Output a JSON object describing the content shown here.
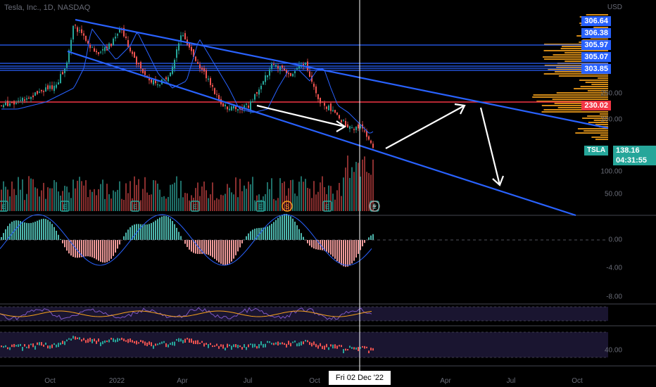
{
  "header": {
    "title": "Tesla, Inc., 1D, NASDAQ"
  },
  "price_axis": {
    "unit_label": "USD",
    "ticks": [
      "250.00",
      "200.00",
      "100.00",
      "50.00"
    ]
  },
  "price_badges": [
    {
      "value": "306.64",
      "color": "#2962ff"
    },
    {
      "value": "306.38",
      "color": "#2962ff"
    },
    {
      "value": "305.97",
      "color": "#2962ff"
    },
    {
      "value": "305.07",
      "color": "#2962ff"
    },
    {
      "value": "303.85",
      "color": "#2962ff"
    },
    {
      "value": "230.02",
      "color": "#f23645"
    }
  ],
  "symbol": {
    "ticker": "TSLA",
    "last_price": "138.16",
    "countdown": "04:31:55"
  },
  "time_axis": {
    "labels": [
      "Oct",
      "2022",
      "Apr",
      "Jul",
      "Oct",
      "Apr",
      "Jul",
      "Oct"
    ],
    "crosshair_date": "Fri 02 Dec '22"
  },
  "event_markers": [
    "E",
    "E",
    "E",
    "E",
    "E",
    "S",
    "E",
    "E"
  ],
  "macd_axis": {
    "ticks": [
      "0.00",
      "-4.00",
      "-8.00"
    ]
  },
  "lower_axis": {
    "ticks": [
      "40.00"
    ]
  },
  "colors": {
    "background": "#000000",
    "trendline": "#2962ff",
    "resistance": "#f23645",
    "up": "#26a69a",
    "down": "#ef5350",
    "volume_profile": "#f7a21b",
    "ma_line": "#2962ff"
  }
}
